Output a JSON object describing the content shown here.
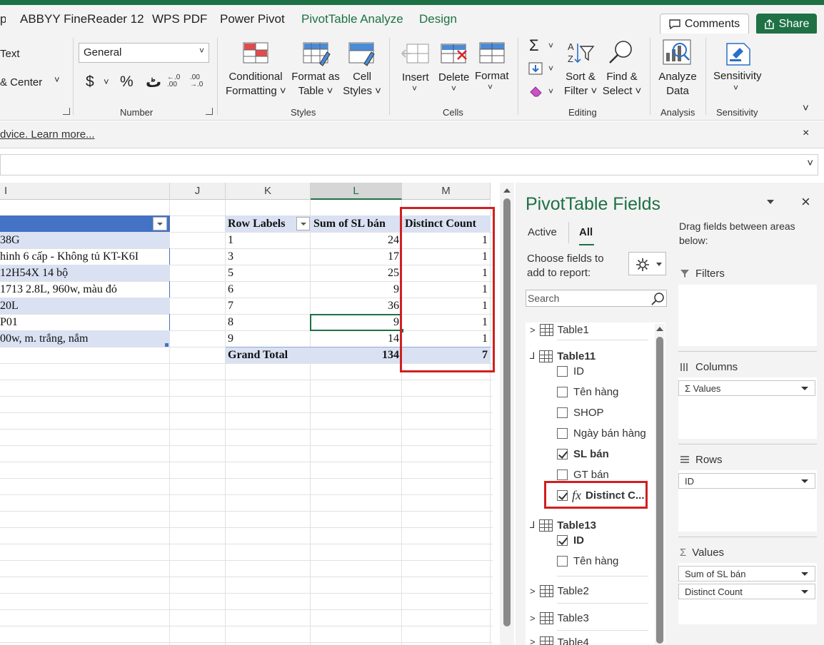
{
  "menubar": {
    "tabs": [
      "ABBYY FineReader 12",
      "WPS PDF",
      "Power Pivot",
      "PivotTable Analyze",
      "Design"
    ],
    "comments_label": "Comments",
    "share_label": "Share"
  },
  "ribbon": {
    "alignment": {
      "wrap_text": "Text",
      "merge_center": "& Center"
    },
    "number": {
      "format_value": "General",
      "dollar": "$",
      "percent": "%",
      "comma": "ٹ",
      "group_name": "Number"
    },
    "styles": {
      "conditional_formatting": [
        "Conditional",
        "Formatting ˅"
      ],
      "format_as_table": [
        "Format as",
        "Table ˅"
      ],
      "cell_styles": [
        "Cell",
        "Styles ˅"
      ],
      "group_name": "Styles"
    },
    "cells": {
      "insert": "Insert",
      "delete": "Delete",
      "format": "Format",
      "group_name": "Cells"
    },
    "editing": {
      "sort_filter": [
        "Sort &",
        "Filter ˅"
      ],
      "find_select": [
        "Find &",
        "Select ˅"
      ],
      "group_name": "Editing"
    },
    "analysis": {
      "analyze_data": [
        "Analyze",
        "Data"
      ],
      "group_name": "Analysis"
    },
    "sensitivity": {
      "label": "Sensitivity",
      "group_name": "Sensitivity"
    }
  },
  "infobar": {
    "text": "dvice. Learn more..."
  },
  "grid": {
    "columns": [
      "I",
      "J",
      "K",
      "L",
      "M"
    ],
    "source_rows": [
      "38G",
      "hinh  6 cấp - Không tủ KT-K6I",
      "12H54X 14 bộ",
      "1713 2.8L, 960w, màu đỏ",
      "20L",
      "P01",
      "00w, m. trắng, nắm"
    ],
    "pivot": {
      "headers": [
        "Row Labels",
        "Sum of SL bán",
        "Distinct Count"
      ],
      "rows": [
        {
          "label": "1",
          "sum": "24",
          "distinct": "1"
        },
        {
          "label": "3",
          "sum": "17",
          "distinct": "1"
        },
        {
          "label": "5",
          "sum": "25",
          "distinct": "1"
        },
        {
          "label": "6",
          "sum": "9",
          "distinct": "1"
        },
        {
          "label": "7",
          "sum": "36",
          "distinct": "1"
        },
        {
          "label": "8",
          "sum": "9",
          "distinct": "1"
        },
        {
          "label": "9",
          "sum": "14",
          "distinct": "1"
        }
      ],
      "grand_total": {
        "label": "Grand Total",
        "sum": "134",
        "distinct": "7"
      }
    }
  },
  "pane": {
    "title": "PivotTable Fields",
    "tabs": {
      "active": "Active",
      "all": "All"
    },
    "choose_label": [
      "Choose fields to",
      "add to report:"
    ],
    "search_placeholder": "Search",
    "drag_label": [
      "Drag fields between areas",
      "below:"
    ],
    "tables": [
      {
        "name": "Table1"
      },
      {
        "name": "Table11",
        "fields": [
          {
            "name": "ID",
            "checked": false
          },
          {
            "name": "Tên hàng",
            "checked": false
          },
          {
            "name": "SHOP",
            "checked": false
          },
          {
            "name": "Ngày bán hàng",
            "checked": false
          },
          {
            "name": "SL bán",
            "checked": true
          },
          {
            "name": "GT bán",
            "checked": false
          },
          {
            "name": "Distinct C...",
            "checked": true,
            "measure": true,
            "prefix": "fx"
          }
        ]
      },
      {
        "name": "Table13",
        "fields": [
          {
            "name": "ID",
            "checked": true
          },
          {
            "name": "Tên hàng",
            "checked": false
          }
        ]
      },
      {
        "name": "Table2"
      },
      {
        "name": "Table3"
      },
      {
        "name": "Table4"
      }
    ],
    "areas": {
      "filters": "Filters",
      "columns": {
        "title": "Columns",
        "items": [
          "Σ  Values"
        ]
      },
      "rows": {
        "title": "Rows",
        "items": [
          "ID"
        ]
      },
      "values": {
        "title": "Values",
        "items": [
          "Sum of SL bán",
          "Distinct Count"
        ]
      }
    }
  },
  "colors": {
    "accent": "#1e7145",
    "highlight_box": "#d11f1f",
    "table_header": "#4472c4",
    "table_band": "#d9e1f2"
  }
}
